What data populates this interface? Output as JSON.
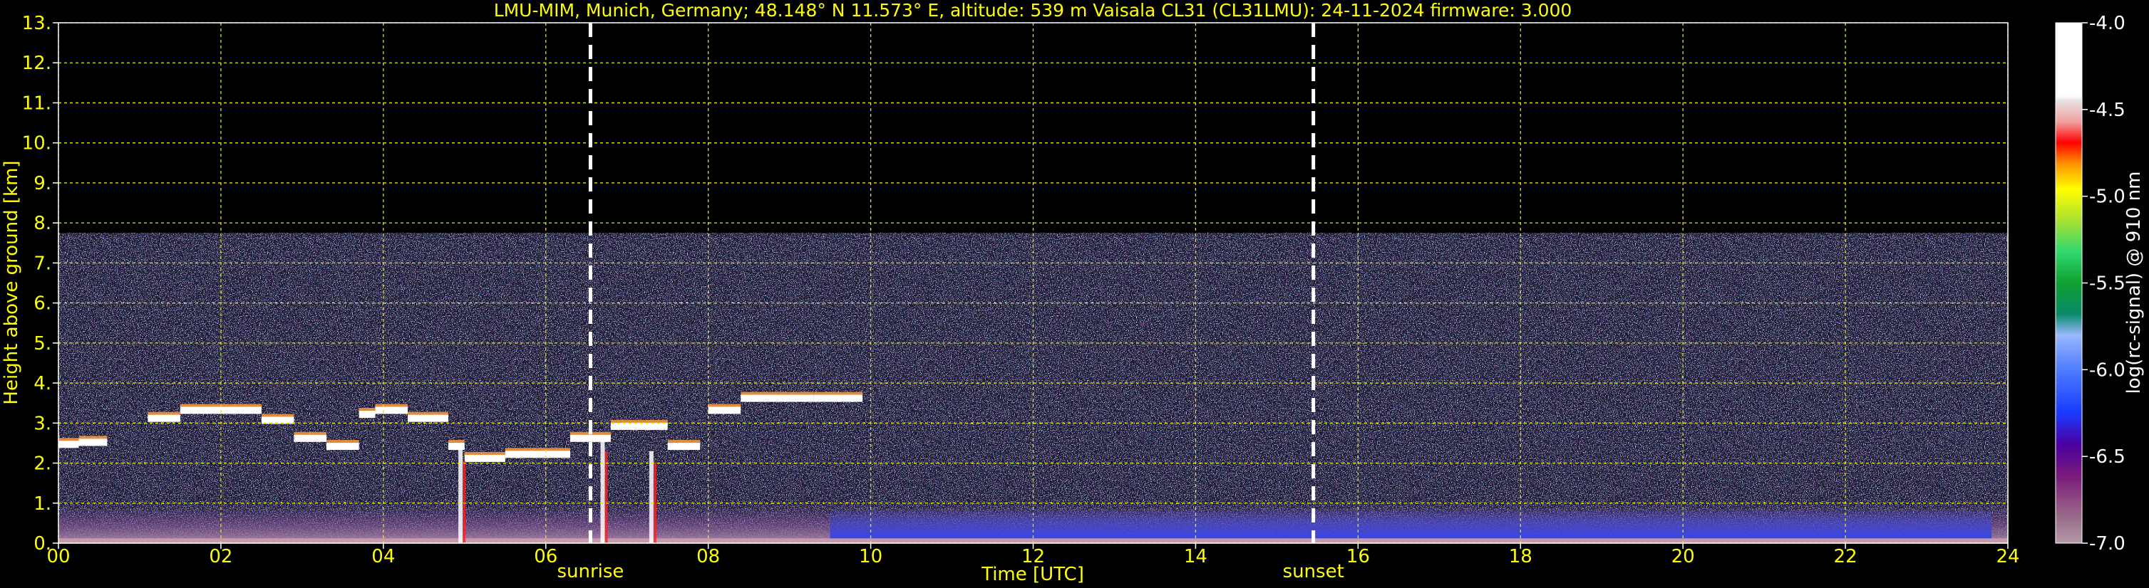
{
  "chart_data": {
    "type": "heatmap",
    "title": "LMU-MIM, Munich, Germany; 48.148° N 11.573° E, altitude: 539 m    Vaisala CL31 (CL31LMU): 24-11-2024    firmware: 3.000",
    "xlabel": "Time [UTC]",
    "ylabel": "Height above ground [km]",
    "xlim": [
      0,
      24
    ],
    "ylim": [
      0,
      13
    ],
    "x_ticks": [
      "00",
      "02",
      "04",
      "06",
      "08",
      "10",
      "12",
      "14",
      "16",
      "18",
      "20",
      "22",
      "24"
    ],
    "y_ticks": [
      "0.",
      "1.",
      "2.",
      "3.",
      "4.",
      "5.",
      "6.",
      "7.",
      "8.",
      "9.",
      "10.",
      "11.",
      "12.",
      "13."
    ],
    "grid": true,
    "colorbar": {
      "label": "log(rc-signal) @ 910 nm",
      "range": [
        -7.0,
        -4.0
      ],
      "ticks": [
        "-4.0",
        "-4.5",
        "-5.0",
        "-5.5",
        "-6.0",
        "-6.5",
        "-7.0"
      ]
    },
    "events": [
      {
        "label": "sunrise",
        "time": 6.55
      },
      {
        "label": "sunset",
        "time": 15.45
      }
    ],
    "signal_top_km": 7.75,
    "cloud_layers": [
      {
        "t_start": 0.0,
        "t_end": 0.25,
        "height_km": 2.45
      },
      {
        "t_start": 0.25,
        "t_end": 0.6,
        "height_km": 2.5
      },
      {
        "t_start": 1.1,
        "t_end": 1.5,
        "height_km": 3.1
      },
      {
        "t_start": 1.5,
        "t_end": 2.5,
        "height_km": 3.3
      },
      {
        "t_start": 2.5,
        "t_end": 2.9,
        "height_km": 3.05
      },
      {
        "t_start": 2.9,
        "t_end": 3.3,
        "height_km": 2.6
      },
      {
        "t_start": 3.3,
        "t_end": 3.7,
        "height_km": 2.4
      },
      {
        "t_start": 3.7,
        "t_end": 3.9,
        "height_km": 3.2
      },
      {
        "t_start": 3.9,
        "t_end": 4.3,
        "height_km": 3.3
      },
      {
        "t_start": 4.3,
        "t_end": 4.8,
        "height_km": 3.1
      },
      {
        "t_start": 4.8,
        "t_end": 5.0,
        "height_km": 2.4
      },
      {
        "t_start": 5.0,
        "t_end": 5.5,
        "height_km": 2.1
      },
      {
        "t_start": 5.5,
        "t_end": 6.3,
        "height_km": 2.2
      },
      {
        "t_start": 6.3,
        "t_end": 6.8,
        "height_km": 2.6
      },
      {
        "t_start": 6.8,
        "t_end": 7.5,
        "height_km": 2.9
      },
      {
        "t_start": 7.5,
        "t_end": 7.9,
        "height_km": 2.4
      },
      {
        "t_start": 8.0,
        "t_end": 8.4,
        "height_km": 3.3
      },
      {
        "t_start": 8.4,
        "t_end": 9.3,
        "height_km": 3.6
      },
      {
        "t_start": 9.3,
        "t_end": 9.9,
        "height_km": 3.6
      }
    ]
  }
}
